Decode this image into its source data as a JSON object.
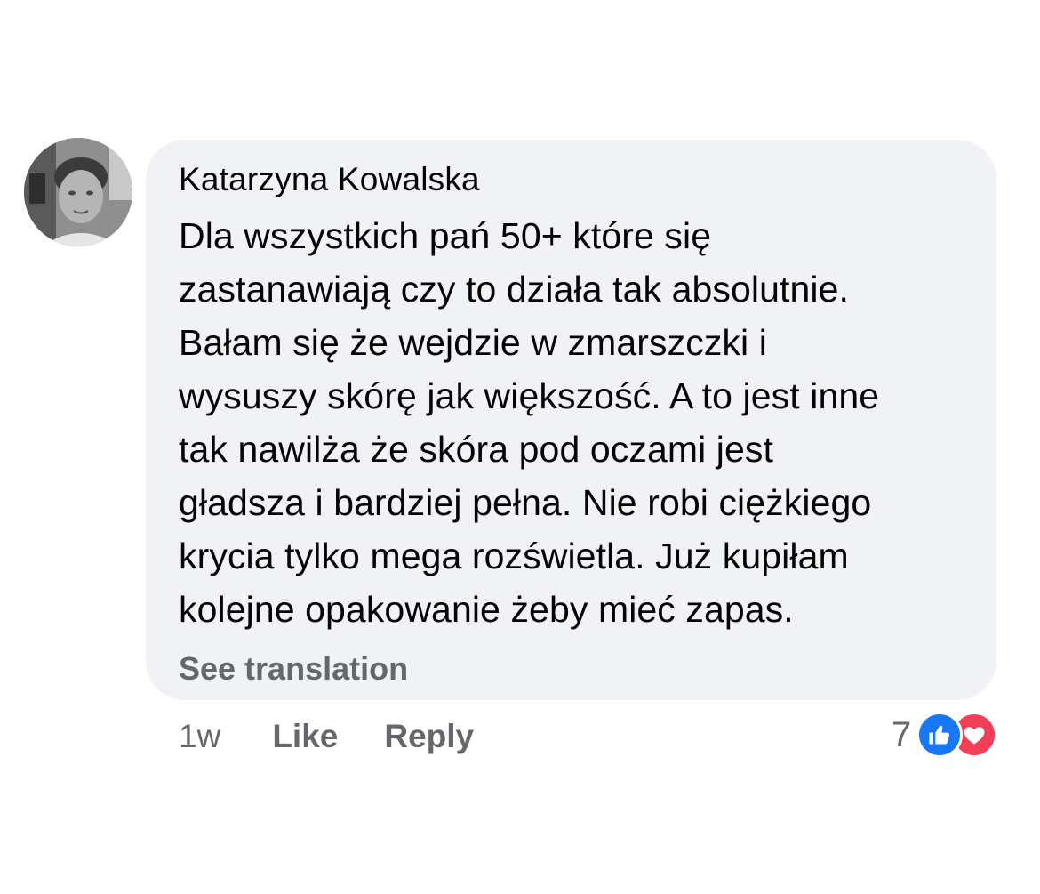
{
  "comment": {
    "author": "Katarzyna Kowalska",
    "text_lines": [
      "Dla wszystkich pań 50+ które się",
      "zastanawiają czy to działa tak absolutnie.",
      "Bałam się że wejdzie w zmarszczki i",
      "wysuszy skórę jak większość. A to jest inne",
      "tak nawilża że skóra pod oczami jest",
      "gładsza i bardziej pełna. Nie robi ciężkiego",
      "krycia tylko mega rozświetla. Już kupiłam",
      "kolejne opakowanie żeby mieć zapas."
    ],
    "see_translation": "See translation"
  },
  "actions": {
    "time": "1w",
    "like_label": "Like",
    "reply_label": "Reply"
  },
  "reactions": {
    "count": "7",
    "icons": [
      "like-icon",
      "love-icon"
    ],
    "like_color": "#1877f2",
    "love_color": "#f33e58"
  }
}
